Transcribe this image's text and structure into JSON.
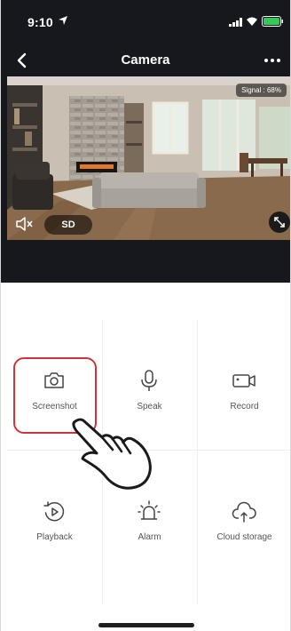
{
  "status": {
    "time": "9:10"
  },
  "nav": {
    "title": "Camera"
  },
  "video": {
    "signal": "Signal : 68%",
    "quality": "SD"
  },
  "tiles": [
    {
      "label": "Screenshot",
      "icon": "camera-icon"
    },
    {
      "label": "Speak",
      "icon": "microphone-icon"
    },
    {
      "label": "Record",
      "icon": "video-camera-icon"
    },
    {
      "label": "Playback",
      "icon": "playback-icon"
    },
    {
      "label": "Alarm",
      "icon": "alarm-siren-icon"
    },
    {
      "label": "Cloud storage",
      "icon": "cloud-storage-icon"
    }
  ],
  "colors": {
    "header_bg": "#16181d",
    "highlight": "#d0323a",
    "text": "#555555"
  }
}
